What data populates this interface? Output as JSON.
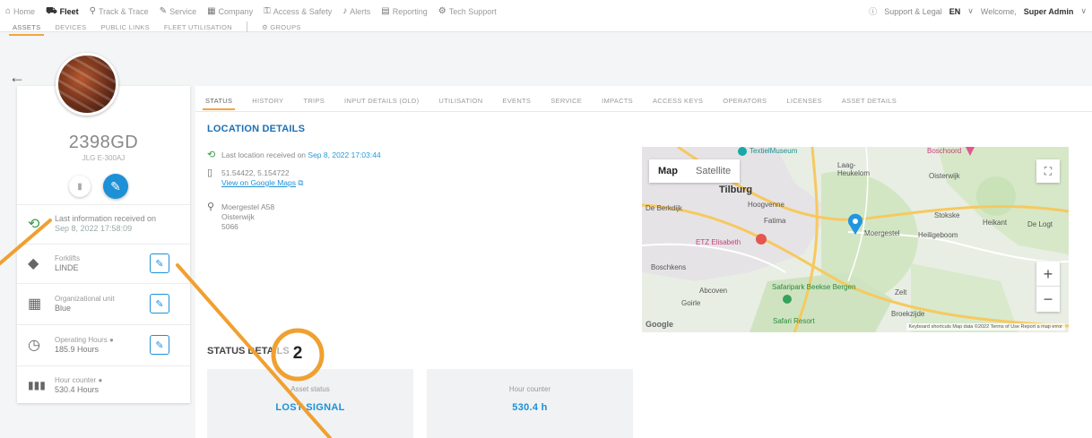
{
  "nav": {
    "items": [
      {
        "label": "Home",
        "icon": "home-icon",
        "glyph": "⌂"
      },
      {
        "label": "Fleet",
        "icon": "truck-icon",
        "glyph": "⛟"
      },
      {
        "label": "Track & Trace",
        "icon": "pin-icon",
        "glyph": "⚲"
      },
      {
        "label": "Service",
        "icon": "wrench-icon",
        "glyph": "✎"
      },
      {
        "label": "Company",
        "icon": "building-icon",
        "glyph": "▦"
      },
      {
        "label": "Access & Safety",
        "icon": "key-icon",
        "glyph": "⚿"
      },
      {
        "label": "Alerts",
        "icon": "bell-icon",
        "glyph": "♪"
      },
      {
        "label": "Reporting",
        "icon": "chart-icon",
        "glyph": "▤"
      },
      {
        "label": "Tech Support",
        "icon": "gear-icon",
        "glyph": "⚙"
      }
    ],
    "support": "Support & Legal",
    "language": "EN",
    "welcome": "Welcome,",
    "user": "Super Admin"
  },
  "subnav": {
    "items": [
      "ASSETS",
      "DEVICES",
      "PUBLIC LINKS",
      "FLEET UTILISATION"
    ],
    "groups": "GROUPS"
  },
  "asset": {
    "name": "2398GD",
    "subtitle": "JLG E-300AJ",
    "last_info_label": "Last information received on",
    "last_info_date": "Sep 8, 2022 17:58:09",
    "rows": [
      {
        "label": "Forklifts",
        "value": "LINDE"
      },
      {
        "label": "Organizational unit",
        "value": "Blue"
      },
      {
        "label": "Operating Hours",
        "value": "185.9 Hours"
      },
      {
        "label": "Hour counter",
        "value": "530.4 Hours"
      }
    ]
  },
  "tabs": [
    "STATUS",
    "HISTORY",
    "TRIPS",
    "INPUT DETAILS (OLD)",
    "UTILISATION",
    "EVENTS",
    "SERVICE",
    "IMPACTS",
    "ACCESS KEYS",
    "OPERATORS",
    "LICENSES",
    "ASSET DETAILS"
  ],
  "location": {
    "title": "LOCATION DETAILS",
    "received_label": "Last location received on",
    "received_date": "Sep 8, 2022 17:03:44",
    "coords": "51.54422, 5.154722",
    "maps_link": "View on Google Maps",
    "address": [
      "Moergestel A58",
      "Oisterwijk",
      "5066"
    ]
  },
  "map": {
    "type_map": "Map",
    "type_satellite": "Satellite",
    "labels": {
      "textile": "TextielMuseum",
      "tilburg": "Tilburg",
      "laag": "Laag-Heukelom",
      "oisterwijk": "Oisterwijk",
      "boschoord": "Boschoord",
      "berkdijk": "De Berkdijk",
      "hoogvenne": "Hoogvenne",
      "fatima": "Fatima",
      "stokske": "Stokske",
      "heikant": "Heikant",
      "delogt": "De Logt",
      "moergestel": "Moergestel",
      "heiligeboom": "Heiligeboom",
      "etz": "ETZ Elisabeth",
      "boschkens": "Boschkens",
      "abcoven": "Abcoven",
      "goirle": "Goirle",
      "safaripark": "Safaripark Beekse Bergen",
      "zelt": "Zelt",
      "broekzijde": "Broekzijde",
      "safariresort": "Safari Resort"
    },
    "google": "Google",
    "attribution": "Keyboard shortcuts   Map data ©2022   Terms of Use   Report a map error"
  },
  "status": {
    "title": "STATUS DETAILS",
    "cards": [
      {
        "label": "Asset status",
        "value": "LOST SIGNAL"
      },
      {
        "label": "Hour counter",
        "value": "530.4 h"
      }
    ]
  },
  "annotation": {
    "step": "2"
  },
  "colors": {
    "accent": "#f3a53c",
    "primary": "#1e90d6",
    "annotation": "#f0a030"
  }
}
